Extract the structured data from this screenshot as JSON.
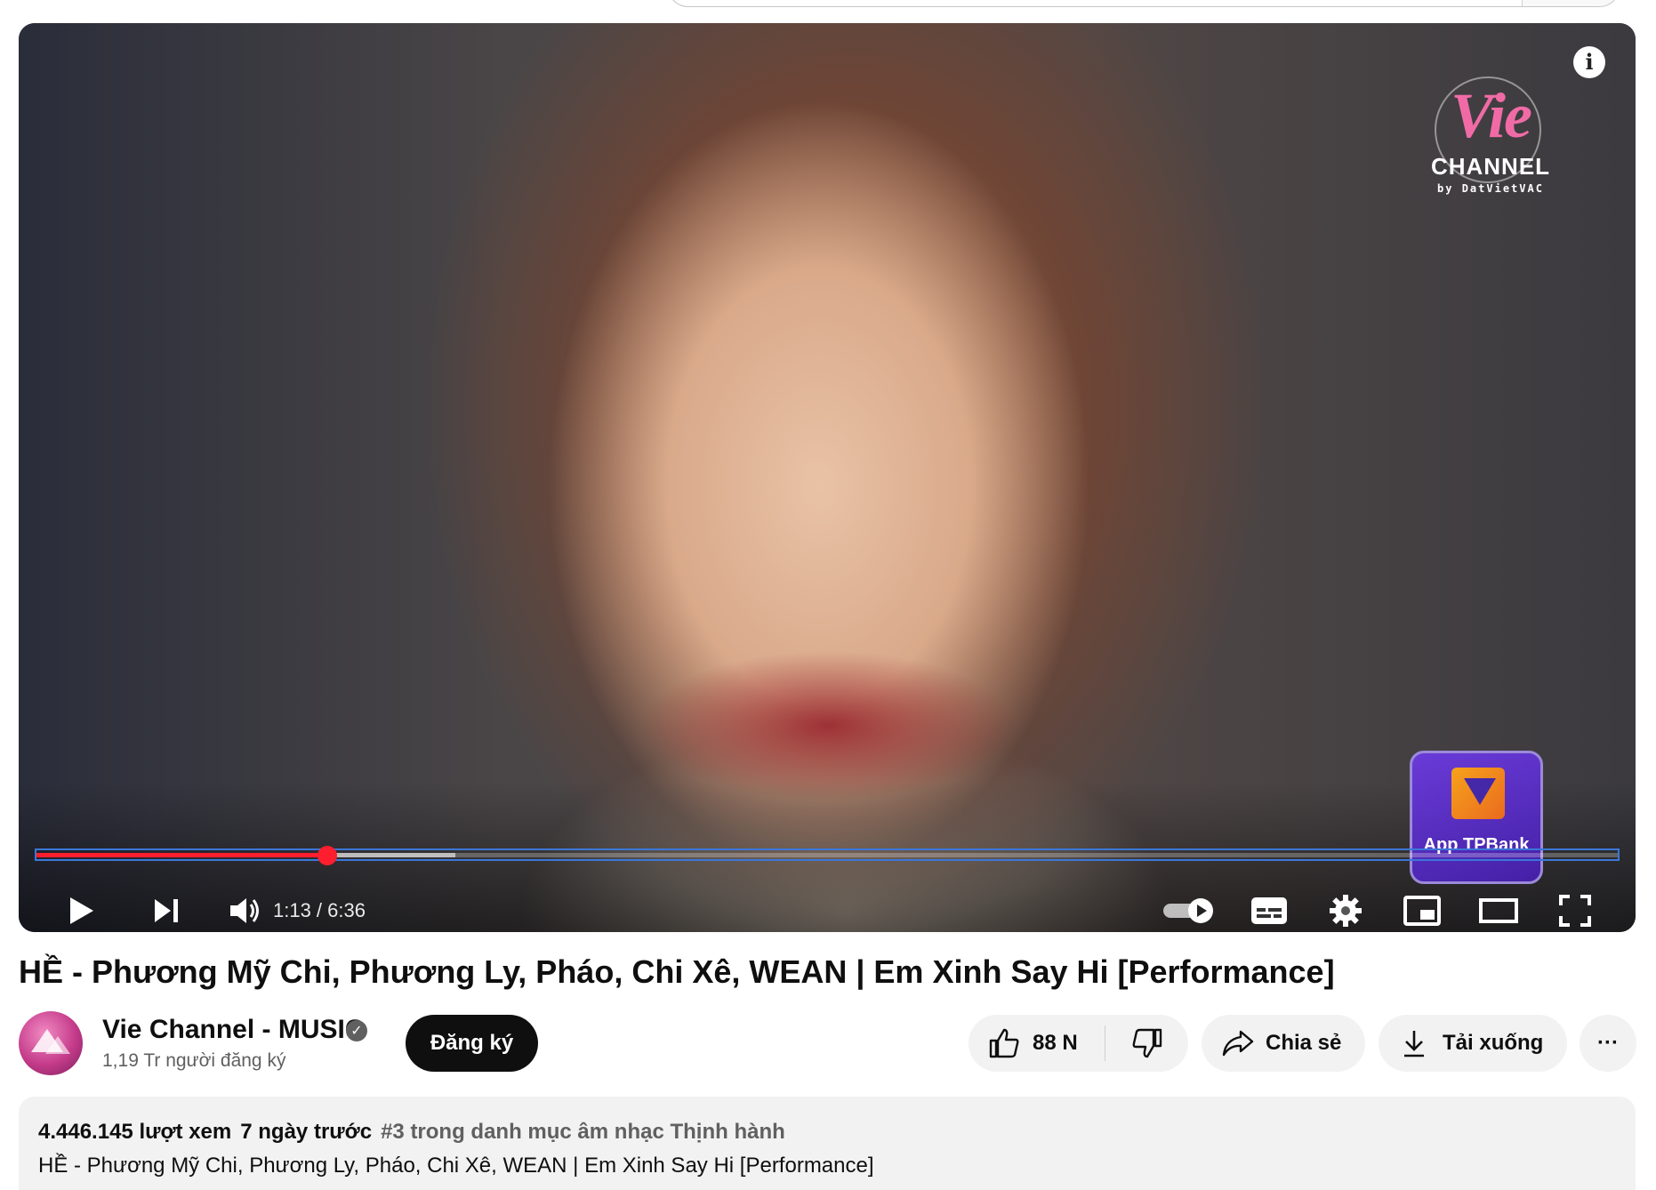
{
  "player": {
    "time_current": "1:13",
    "time_total": "6:36",
    "time_display": "1:13 / 6:36",
    "progress_fraction": 0.184,
    "buffered_fraction": 0.265,
    "info_label": "i",
    "watermark": {
      "brand": "Vie",
      "sub": "CHANNEL",
      "by": "by DatVietVAC"
    },
    "sponsor_card": "App TPBank",
    "accent_color": "#ff1e2d"
  },
  "video": {
    "title": "HỀ - Phương Mỹ Chi, Phương Ly, Pháo, Chi Xê, WEAN | Em Xinh Say Hi [Performance]"
  },
  "channel": {
    "name": "Vie Channel - MUSIC",
    "subscribers": "1,19 Tr người đăng ký",
    "verified_icon": "check-icon",
    "subscribe_label": "Đăng ký"
  },
  "actions": {
    "likes": "88 N",
    "share_label": "Chia sẻ",
    "download_label": "Tải xuống",
    "more_label": "···"
  },
  "description": {
    "views": "4.446.145 lượt xem",
    "ago": "7 ngày trước",
    "trending": "#3 trong danh mục âm nhạc Thịnh hành",
    "text": "HỀ - Phương Mỹ Chi, Phương Ly, Pháo, Chi Xê, WEAN | Em Xinh Say Hi [Performance]"
  }
}
